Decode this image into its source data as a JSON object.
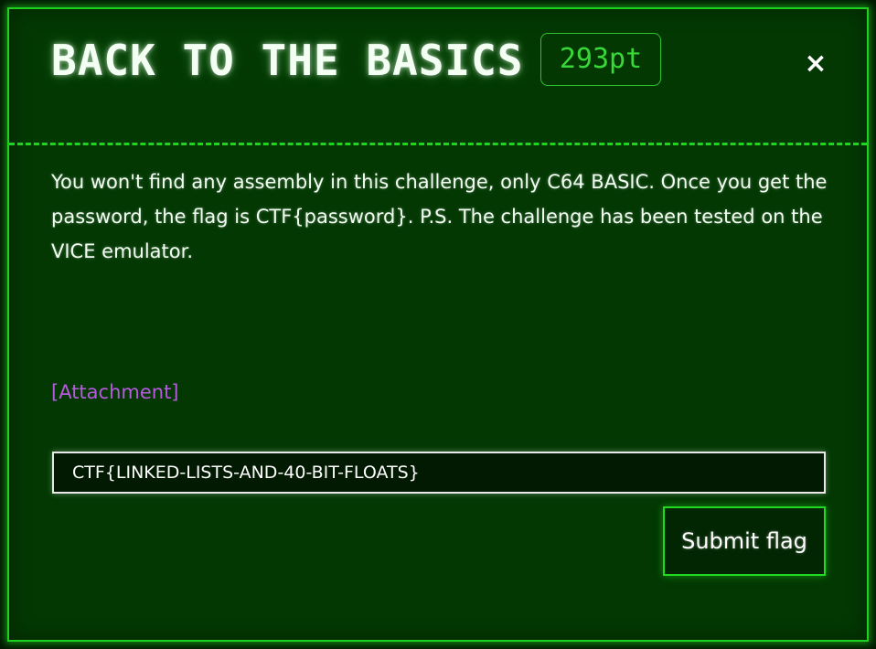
{
  "modal": {
    "title": "BACK TO THE BASICS",
    "points": "293pt",
    "close_label": "×"
  },
  "challenge": {
    "description": "You won't find any assembly in this challenge, only C64 BASIC. Once you get the password, the flag is CTF{password}. P.S. The challenge has been tested on the VICE emulator.",
    "attachment_label": "[Attachment]"
  },
  "flag_form": {
    "input_value": "CTF{LINKED-LISTS-AND-40-BIT-FLOATS}",
    "submit_label": "Submit flag"
  },
  "colors": {
    "background": "#033803",
    "accent": "#1fd11f",
    "link": "#b75adf",
    "text": "#f2fff2"
  },
  "icons": {
    "close": "close-icon"
  }
}
